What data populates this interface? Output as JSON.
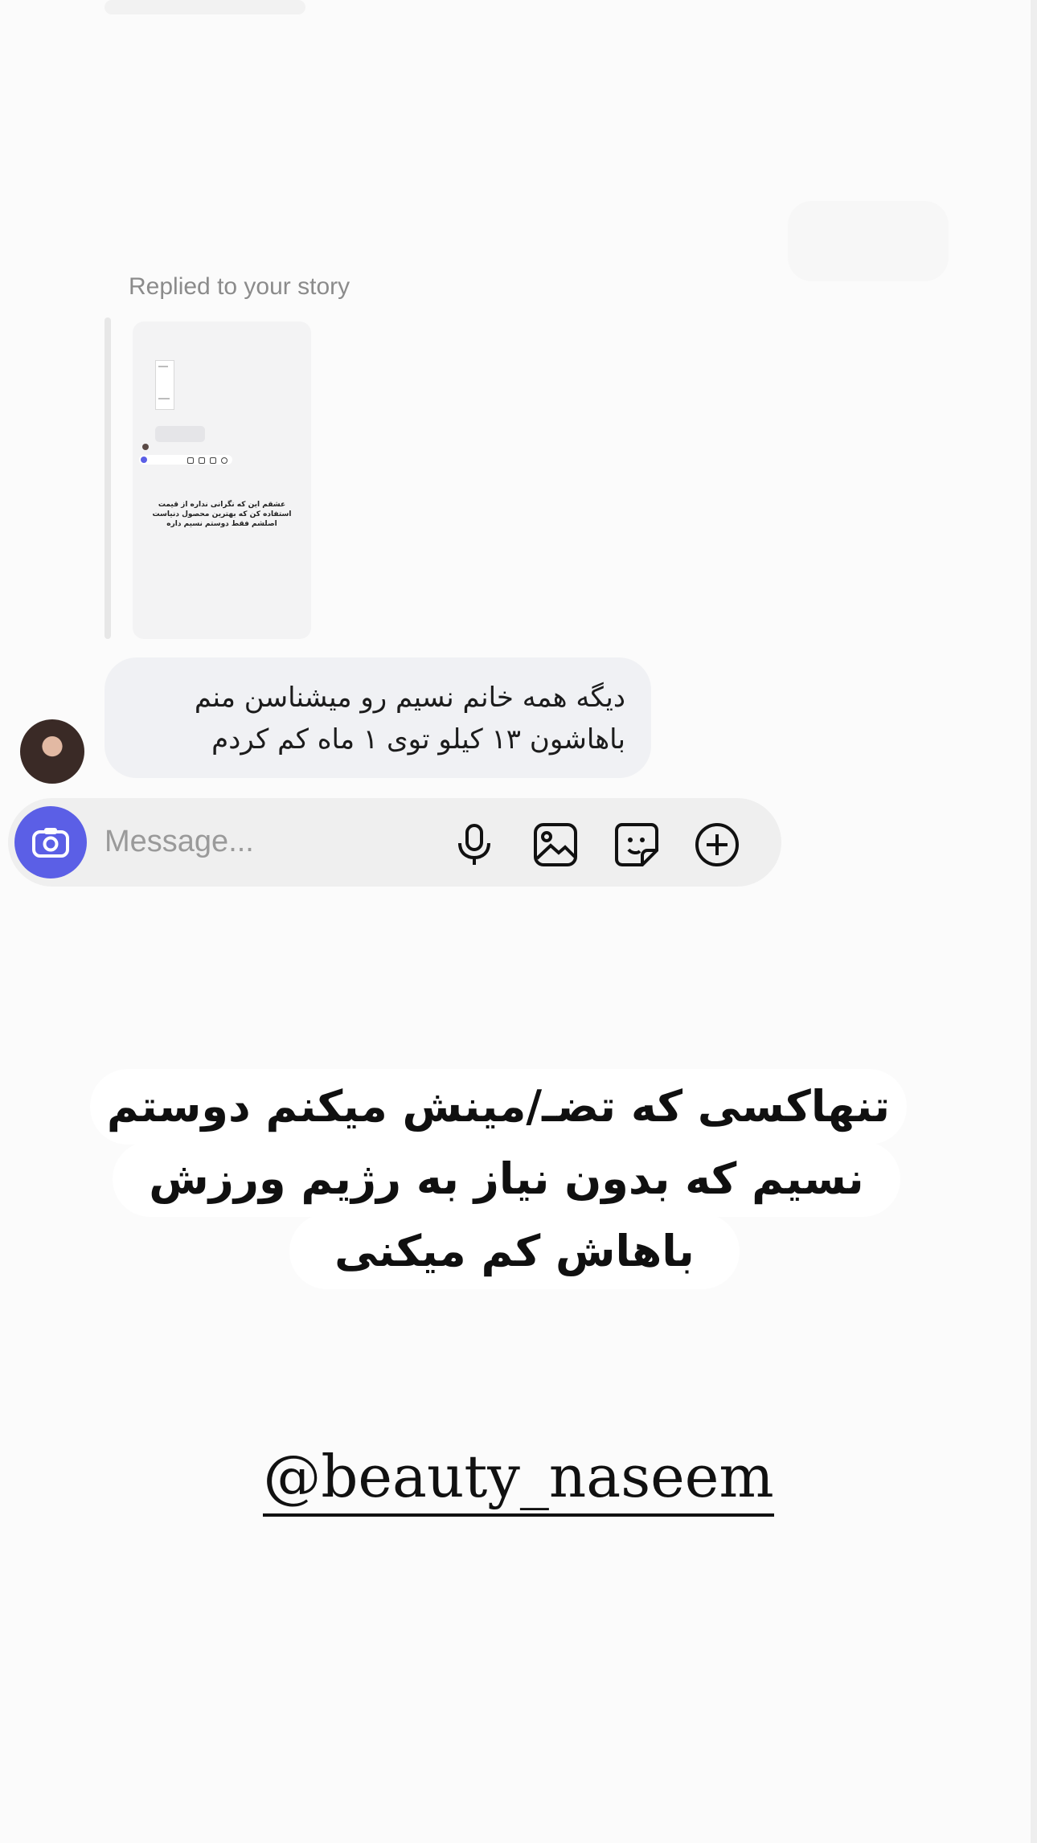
{
  "chat": {
    "reply_label": "Replied to your story",
    "story_thumbnail": {
      "caption_lines": [
        "عشقم این که نگرانی نداره از قیمت",
        "استفاده کن که بهترین محصول دنیاست",
        "اصلشم فقط دوستم نسیم داره"
      ]
    },
    "message_lines": [
      "دیگه همه خانم نسیم رو میشناسن منم",
      "باهاشون ۱۳ کیلو توی ۱ ماه کم کردم"
    ]
  },
  "composer": {
    "placeholder": "Message...",
    "camera_icon": "camera-icon",
    "icons": [
      "microphone-icon",
      "gallery-icon",
      "sticker-icon",
      "plus-circle-icon"
    ]
  },
  "overlay": {
    "lines": [
      "تنهاکسی که تضـ/مینش میکنم دوستم",
      "نسیم که بدون نیاز به رژیم ورزش",
      "باهاش کم میکنی"
    ]
  },
  "account": {
    "handle": "@beauty_naseem"
  },
  "colors": {
    "accent": "#5b5fe6",
    "background": "#fbfbfb",
    "bubble": "#f0f1f4"
  }
}
